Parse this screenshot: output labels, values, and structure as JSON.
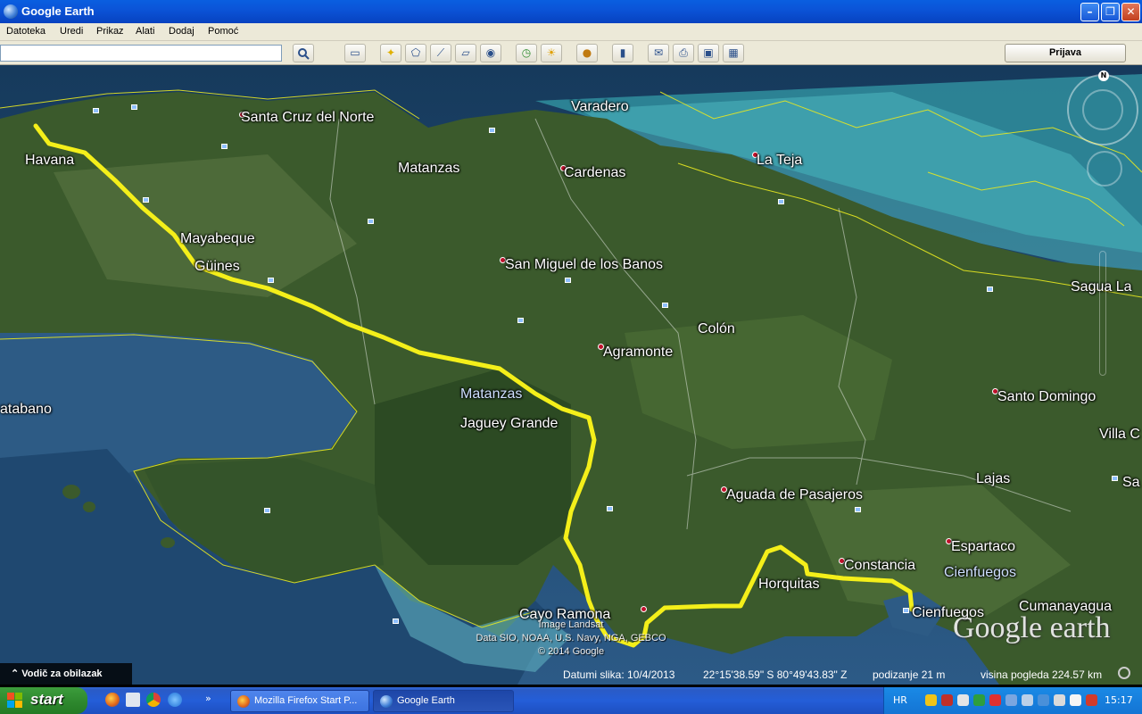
{
  "window": {
    "title": "Google Earth",
    "minimize": "–",
    "maximize": "❐",
    "close": "✕"
  },
  "menu": [
    "Datoteka",
    "Uredi",
    "Prikaz",
    "Alati",
    "Dodaj",
    "Pomoć"
  ],
  "toolbar": {
    "search_value": "",
    "search_icon": "magnifier-icon",
    "signin_label": "Prijava",
    "tools": [
      "sidebar-icon",
      "placemark-icon",
      "polygon-icon",
      "path-icon",
      "overlay-icon",
      "tour-icon",
      "history-icon",
      "sunlight-icon",
      "planets-icon",
      "ruler-icon",
      "email-icon",
      "print-icon",
      "save-image-icon",
      "maps-icon"
    ]
  },
  "map": {
    "places": [
      {
        "label": "Santa Cruz del Norte"
      },
      {
        "label": "Varadero"
      },
      {
        "label": "Havana"
      },
      {
        "label": "Matanzas"
      },
      {
        "label": "Cardenas"
      },
      {
        "label": "La Teja"
      },
      {
        "label": "Mayabeque"
      },
      {
        "label": "Güines"
      },
      {
        "label": "San Miguel de los Banos"
      },
      {
        "label": "Sagua La"
      },
      {
        "label": "Colón"
      },
      {
        "label": "Agramonte"
      },
      {
        "label": "atabano"
      },
      {
        "label": "Matanzas"
      },
      {
        "label": "Santo Domingo"
      },
      {
        "label": "Jaguey Grande"
      },
      {
        "label": "Villa C"
      },
      {
        "label": "Lajas"
      },
      {
        "label": "Sa"
      },
      {
        "label": "Aguada de Pasajeros"
      },
      {
        "label": "Espartaco"
      },
      {
        "label": "Constancia"
      },
      {
        "label": "Cienfuegos"
      },
      {
        "label": "Horquitas"
      },
      {
        "label": "Cumanayagua"
      },
      {
        "label": "Cienfuegos"
      },
      {
        "label": "Cayo Ramona"
      }
    ],
    "attribution": [
      "Image Landsat",
      "Data SIO, NOAA, U.S. Navy, NGA, GEBCO",
      "© 2014 Google"
    ],
    "logo": "Google earth",
    "north_label": "N",
    "route_color": "#f4ef1a",
    "boundary_color": "#e8e820"
  },
  "status": {
    "tour_guide": "Vodič za obilazak",
    "tour_guide_icon": "chevron-up-icon",
    "imagery_date": "Datumi slika: 10/4/2013",
    "coordinates": "22°15'38.59\" S   80°49'43.83\" Z",
    "elevation": "podizanje    21 m",
    "eye_alt": "visina pogleda 224.57 km"
  },
  "taskbar": {
    "start": "start",
    "tasks": [
      {
        "label": "Mozilla Firefox Start P...",
        "icon": "firefox-icon"
      },
      {
        "label": "Google Earth",
        "icon": "google-earth-icon"
      }
    ],
    "language": "HR",
    "clock": "15:17",
    "quicklaunch_more": "»"
  }
}
